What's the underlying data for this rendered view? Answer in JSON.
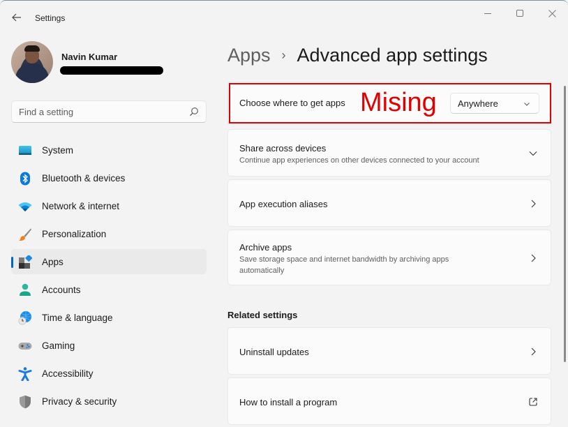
{
  "window": {
    "title": "Settings",
    "controls": {
      "minimize": "minimize",
      "maximize": "maximize",
      "close": "close"
    }
  },
  "profile": {
    "name": "Navin Kumar",
    "email": "[redacted]"
  },
  "search": {
    "placeholder": "Find a setting",
    "value": ""
  },
  "sidebar": {
    "items": [
      {
        "label": "System",
        "icon": "monitor-icon",
        "active": false
      },
      {
        "label": "Bluetooth & devices",
        "icon": "bluetooth-icon",
        "active": false
      },
      {
        "label": "Network & internet",
        "icon": "wifi-icon",
        "active": false
      },
      {
        "label": "Personalization",
        "icon": "paintbrush-icon",
        "active": false
      },
      {
        "label": "Apps",
        "icon": "apps-icon",
        "active": true
      },
      {
        "label": "Accounts",
        "icon": "person-icon",
        "active": false
      },
      {
        "label": "Time & language",
        "icon": "globe-clock-icon",
        "active": false
      },
      {
        "label": "Gaming",
        "icon": "gamepad-icon",
        "active": false
      },
      {
        "label": "Accessibility",
        "icon": "accessibility-icon",
        "active": false
      },
      {
        "label": "Privacy & security",
        "icon": "shield-icon",
        "active": false
      }
    ]
  },
  "breadcrumb": {
    "parent": "Apps",
    "separator": "›",
    "current": "Advanced app settings"
  },
  "settings": {
    "where_to_get_apps": {
      "label": "Choose where to get apps",
      "selected": "Anywhere",
      "annotation": "Mising"
    },
    "share_across_devices": {
      "title": "Share across devices",
      "description": "Continue app experiences on other devices connected to your account"
    },
    "app_execution_aliases": {
      "title": "App execution aliases"
    },
    "archive_apps": {
      "title": "Archive apps",
      "description": "Save storage space and internet bandwidth by archiving apps automatically"
    }
  },
  "related": {
    "title": "Related settings",
    "items": [
      {
        "title": "Uninstall updates",
        "icon": "chevron-right-icon"
      },
      {
        "title": "How to install a program",
        "icon": "external-link-icon"
      }
    ]
  },
  "colors": {
    "accent": "#0067c0",
    "annotation": "#e00000",
    "background": "#f3f3f3",
    "card": "#fbfbfb"
  }
}
